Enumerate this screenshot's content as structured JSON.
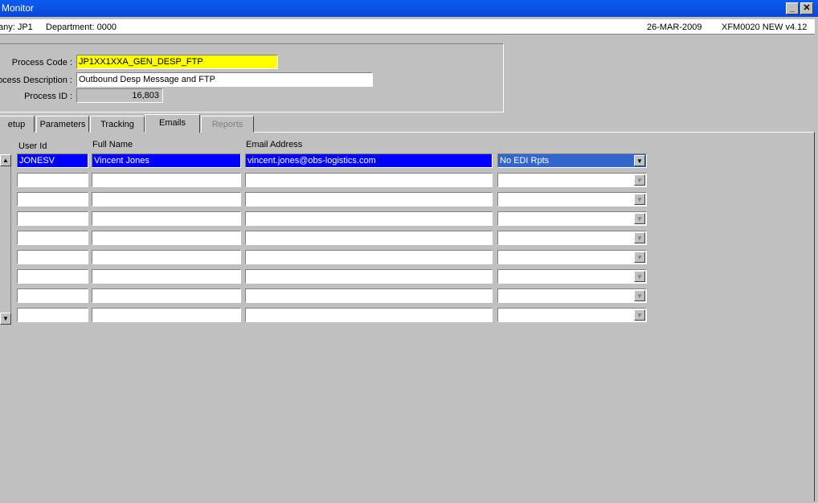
{
  "window": {
    "title": "Monitor"
  },
  "infobar": {
    "company": "any:  JP1",
    "department": "Department:  0000",
    "date": "26-MAR-2009",
    "form": "XFM0020  NEW  v4.12"
  },
  "process": {
    "code_label": "Process Code :",
    "code_value": "JP1XX1XXA_GEN_DESP_FTP",
    "desc_label": "ocess Description :",
    "desc_value": "Outbound Desp Message and FTP",
    "id_label": "Process ID :",
    "id_value": "16,803"
  },
  "tabs": [
    {
      "label": "etup"
    },
    {
      "label": "Parameters"
    },
    {
      "label": "Tracking"
    },
    {
      "label": "Emails"
    },
    {
      "label": "Reports"
    }
  ],
  "table": {
    "headers": {
      "user_id": "User Id",
      "full_name": "Full Name",
      "email": "Email Address"
    },
    "rows": [
      {
        "user_id": "JONESV",
        "full_name": "Vincent Jones",
        "email": "vincent.jones@obs-logistics.com",
        "type": "No EDI Rpts"
      },
      {
        "user_id": "",
        "full_name": "",
        "email": "",
        "type": ""
      },
      {
        "user_id": "",
        "full_name": "",
        "email": "",
        "type": ""
      },
      {
        "user_id": "",
        "full_name": "",
        "email": "",
        "type": ""
      },
      {
        "user_id": "",
        "full_name": "",
        "email": "",
        "type": ""
      },
      {
        "user_id": "",
        "full_name": "",
        "email": "",
        "type": ""
      },
      {
        "user_id": "",
        "full_name": "",
        "email": "",
        "type": ""
      },
      {
        "user_id": "",
        "full_name": "",
        "email": "",
        "type": ""
      },
      {
        "user_id": "",
        "full_name": "",
        "email": "",
        "type": ""
      }
    ]
  },
  "icons": {
    "minimize": "minimize-icon",
    "close": "close-icon",
    "scroll_up": "arrow-up-icon",
    "scroll_down": "arrow-down-icon",
    "dropdown": "chevron-down-icon"
  }
}
